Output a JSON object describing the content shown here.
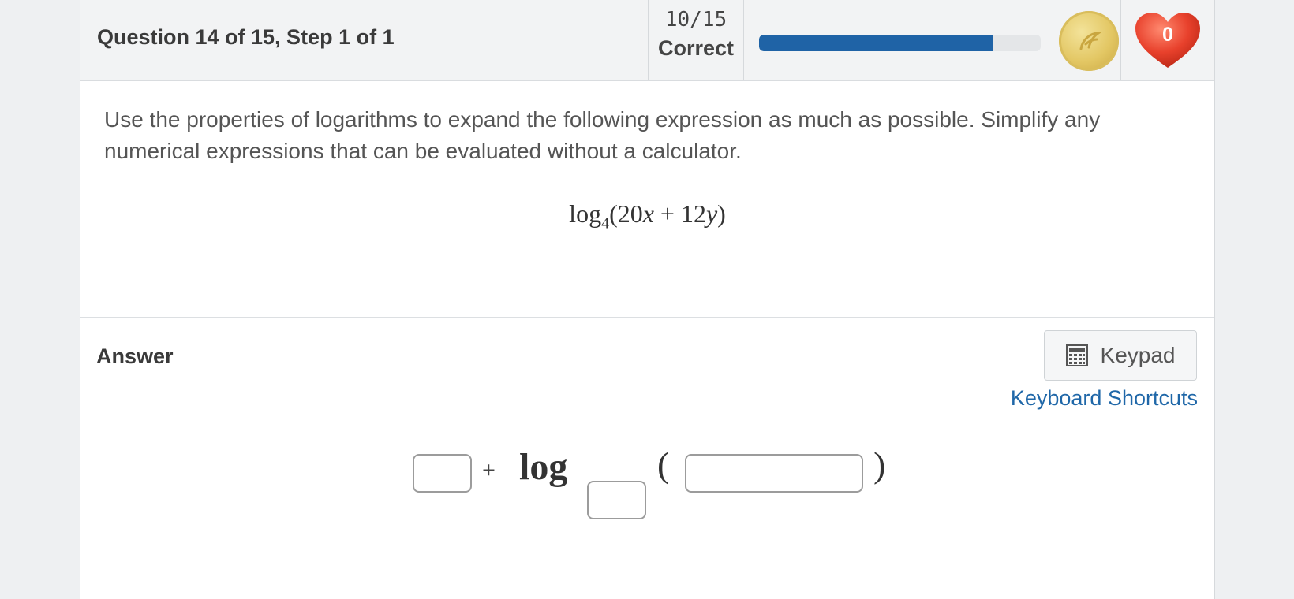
{
  "header": {
    "question_title": "Question 14 of 15, Step 1 of 1",
    "score": "10/15",
    "score_label": "Correct",
    "progress_fraction": 0.83,
    "hearts": "0"
  },
  "question": {
    "instructions": "Use the properties of logarithms to expand the following expression as much as possible. Simplify any numerical expressions that can be evaluated without a calculator.",
    "expression": {
      "func": "log",
      "base": "4",
      "argument_parts": [
        "(20",
        "x",
        " + 12",
        "y",
        ")"
      ]
    }
  },
  "answer": {
    "label": "Answer",
    "keypad_label": "Keypad",
    "shortcuts_label": "Keyboard Shortcuts",
    "plus": "+",
    "log_word": "log",
    "open_paren": "(",
    "close_paren": ")"
  },
  "colors": {
    "accent_blue": "#1f63a6",
    "link_blue": "#1f67a8",
    "heart_red": "#e8412c",
    "coin_gold": "#e3c764"
  },
  "icons": [
    "coin-icon",
    "heart-icon",
    "calculator-icon"
  ]
}
